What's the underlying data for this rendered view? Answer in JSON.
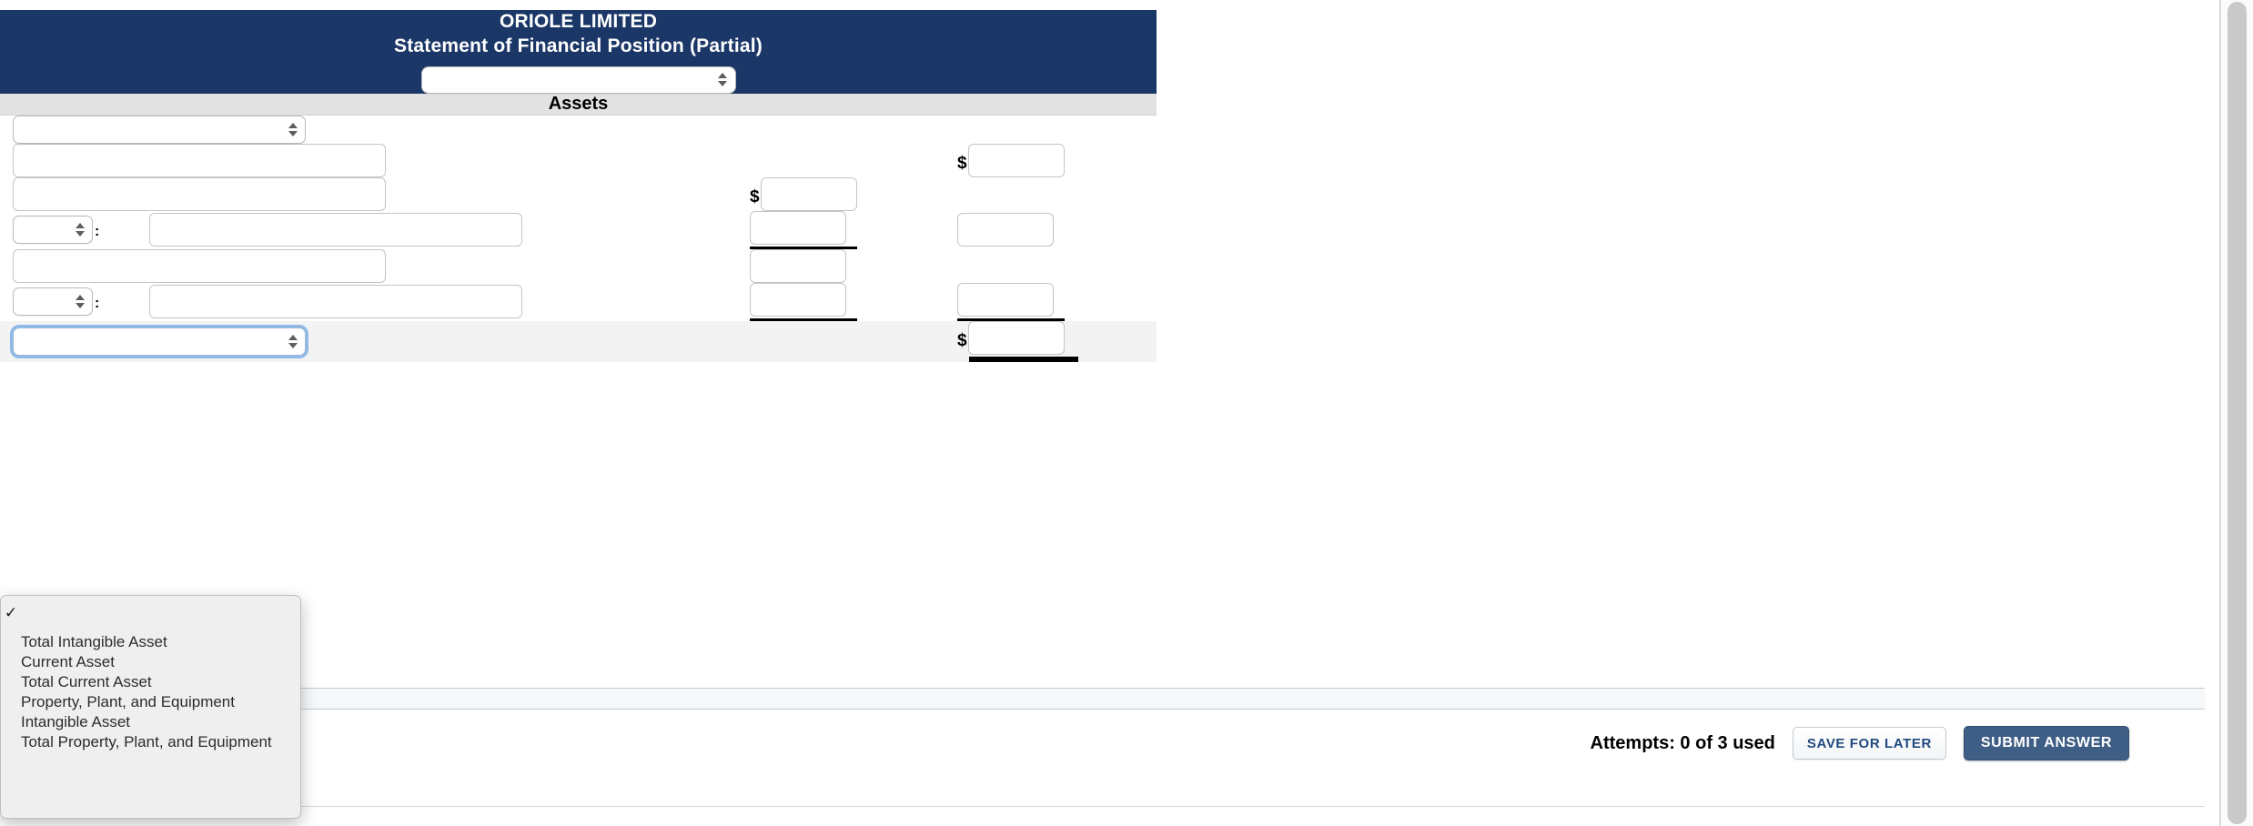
{
  "header": {
    "company": "ORIOLE LIMITED",
    "statement": "Statement of Financial Position (Partial)",
    "period_select_value": "",
    "section_title": "Assets"
  },
  "select_options": [
    "",
    "Total Intangible Asset",
    "Current Asset",
    "Total Current Asset",
    "Property, Plant, and Equipment",
    "Intangible Asset",
    "Total Property, Plant, and Equipment"
  ],
  "rows": [
    {
      "id": "row-1",
      "kind": "category-select",
      "category_value": "",
      "description": "",
      "amount_mid": "",
      "amount_right": ""
    },
    {
      "id": "row-2",
      "kind": "description-amount-right",
      "description": "",
      "dollar_sign": "$",
      "amount_right": ""
    },
    {
      "id": "row-3",
      "kind": "description-amount-mid",
      "description": "",
      "dollar_sign": "$",
      "amount_mid": ""
    },
    {
      "id": "row-4",
      "kind": "indent-select-description",
      "category_value": "",
      "separator": ":",
      "description": "",
      "amount_mid": "",
      "amount_right": ""
    },
    {
      "id": "row-5",
      "kind": "description-amount-mid-plain",
      "description": "",
      "amount_mid": ""
    },
    {
      "id": "row-6",
      "kind": "indent-select-description",
      "category_value": "",
      "separator": ":",
      "description": "",
      "amount_mid": "",
      "amount_right": ""
    },
    {
      "id": "row-7",
      "kind": "total",
      "category_value": "",
      "dollar_sign": "$",
      "amount_right": ""
    }
  ],
  "footer": {
    "attempts": "Attempts: 0 of 3 used",
    "save_label": "SAVE FOR LATER",
    "submit_label": "SUBMIT ANSWER"
  },
  "dropdown": {
    "open": true,
    "checked_index": 0,
    "items": [
      "Total Intangible Asset",
      "Current Asset",
      "Total Current Asset",
      "Property, Plant, and Equipment",
      "Intangible Asset",
      "Total Property, Plant, and Equipment"
    ],
    "check_glyph": "✓"
  },
  "colors": {
    "header_navy": "#1b3767",
    "section_gray": "#e2e2e2",
    "total_band": "#f3f3f3",
    "submit_blue": "#3f5e85",
    "save_text": "#21497f"
  }
}
